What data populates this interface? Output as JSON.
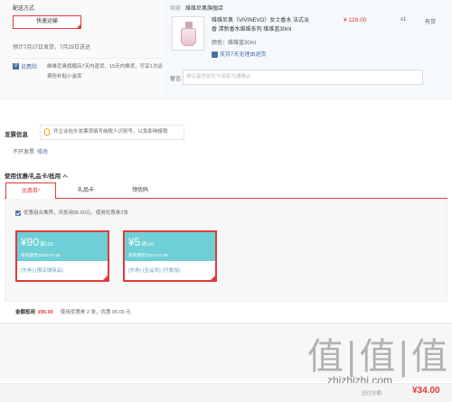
{
  "shipping": {
    "title": "配送方式",
    "button_label": "快速运输",
    "date_text": "预计7月27日发货，7月29日送达",
    "service_icon": "V",
    "service_link": "说费险",
    "service_text": "维维尼奥旗舰店7天内退货，15天内换货，可享1次运费险补贴小金库"
  },
  "shop": {
    "label": "商家:",
    "name": "维维尼奥旗舰店",
    "product_title": "维维尼奥（VIVINEVO）女士香水 法式淡香 清新香水维维系列 维维蓝30ml",
    "price": "¥ 129.00",
    "qty": "x1",
    "stock": "有货",
    "color_line": "颜色：维维蓝30ml",
    "return_text": "支持7天无理由退货",
    "note_label": "留言:",
    "note_placeholder": "建议留言前先与商家沟通确认"
  },
  "invoice": {
    "title": "发票信息",
    "tip": "开企业抬头发票须填写纳税人识别号，以免影响报销",
    "status": "不开发票",
    "edit": "修改"
  },
  "coupons": {
    "title": "使用优惠/礼品卡/抵用",
    "tabs": [
      {
        "label": "优惠券"
      },
      {
        "label": "礼品卡"
      },
      {
        "label": "领优码"
      }
    ],
    "check_text": "优惠组合推荐，共抵用95.00元，使用优惠券2张",
    "cards": [
      {
        "amount": "¥90",
        "cond": "满129",
        "expiry": "有效期至2023-07-28",
        "tags": [
          "[东券]",
          "[限店铺商品]"
        ]
      },
      {
        "amount": "¥5",
        "cond": "满101",
        "expiry": "有效期至2023-07-26",
        "tags": [
          "[东券]",
          "[全品类]",
          "[可叠加]"
        ]
      }
    ],
    "gold_label": "金额抵用",
    "gold_value": "¥95.00",
    "gold_text": "使用优惠券 2 张，优惠 95.00 元"
  },
  "bottom": {
    "watermark": "值|值|值",
    "watermark_url": "zhizhizhi.com",
    "pay_label": "应付总额:",
    "pay_value": "¥34.00"
  },
  "colors": {
    "accent": "#e4393c",
    "link": "#4c6fa8",
    "coupon": "#6fcfd6"
  }
}
